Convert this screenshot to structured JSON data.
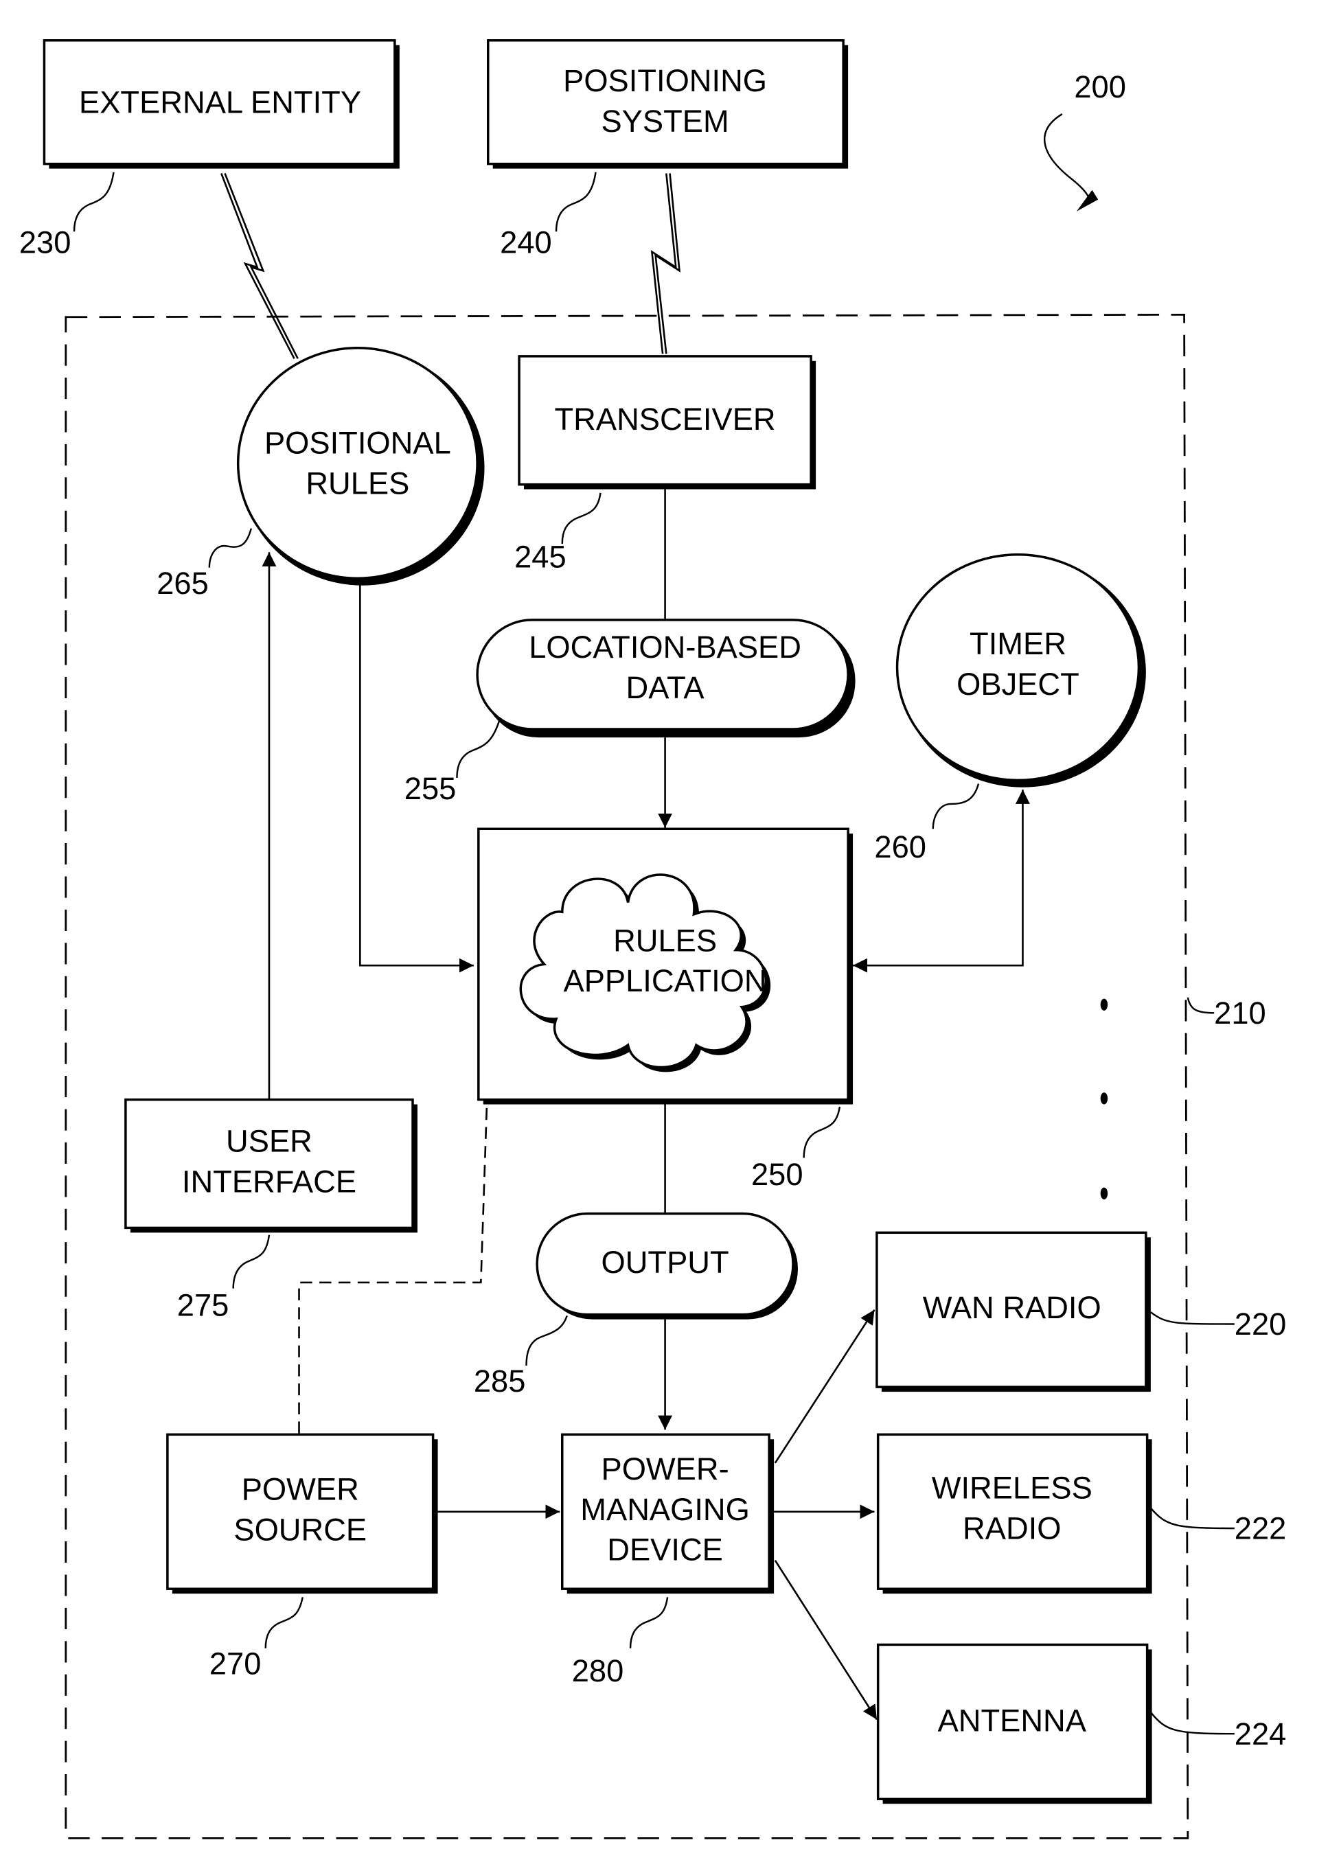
{
  "figure": {
    "ref": "200",
    "container_ref": "210"
  },
  "nodes": {
    "external_entity": {
      "lines": [
        "EXTERNAL ENTITY"
      ],
      "ref": "230"
    },
    "positioning_system": {
      "lines": [
        "POSITIONING",
        "SYSTEM"
      ],
      "ref": "240"
    },
    "positional_rules": {
      "lines": [
        "POSITIONAL",
        "RULES"
      ],
      "ref": "265"
    },
    "transceiver": {
      "lines": [
        "TRANSCEIVER"
      ],
      "ref": "245"
    },
    "location_based_data": {
      "lines": [
        "LOCATION-BASED",
        "DATA"
      ],
      "ref": "255"
    },
    "timer_object": {
      "lines": [
        "TIMER",
        "OBJECT"
      ],
      "ref": "260"
    },
    "rules_application": {
      "lines": [
        "RULES",
        "APPLICATION"
      ],
      "ref": "250"
    },
    "user_interface": {
      "lines": [
        "USER",
        "INTERFACE"
      ],
      "ref": "275"
    },
    "output": {
      "lines": [
        "OUTPUT"
      ],
      "ref": "285"
    },
    "wan_radio": {
      "lines": [
        "WAN RADIO"
      ],
      "ref": "220"
    },
    "power_source": {
      "lines": [
        "POWER",
        "SOURCE"
      ],
      "ref": "270"
    },
    "power_managing_device": {
      "lines": [
        "POWER-",
        "MANAGING",
        "DEVICE"
      ],
      "ref": "280"
    },
    "wireless_radio": {
      "lines": [
        "WIRELESS",
        "RADIO"
      ],
      "ref": "222"
    },
    "antenna": {
      "lines": [
        "ANTENNA"
      ],
      "ref": "224"
    }
  },
  "connections": [
    {
      "from": "external_entity",
      "to": "positional_rules",
      "type": "wireless"
    },
    {
      "from": "positioning_system",
      "to": "transceiver",
      "type": "wireless"
    },
    {
      "from": "transceiver",
      "to": "location_based_data",
      "type": "line"
    },
    {
      "from": "location_based_data",
      "to": "rules_application",
      "type": "arrow"
    },
    {
      "from": "positional_rules",
      "to": "rules_application",
      "type": "arrow"
    },
    {
      "from": "timer_object",
      "to": "rules_application",
      "type": "bidirectional-arrow"
    },
    {
      "from": "user_interface",
      "to": "positional_rules",
      "type": "arrow"
    },
    {
      "from": "rules_application",
      "to": "output",
      "type": "line"
    },
    {
      "from": "output",
      "to": "power_managing_device",
      "type": "arrow"
    },
    {
      "from": "power_source",
      "to": "power_managing_device",
      "type": "arrow"
    },
    {
      "from": "power_source",
      "to": "rules_application",
      "type": "dashed"
    },
    {
      "from": "power_managing_device",
      "to": "wan_radio",
      "type": "arrow"
    },
    {
      "from": "power_managing_device",
      "to": "wireless_radio",
      "type": "arrow"
    },
    {
      "from": "power_managing_device",
      "to": "antenna",
      "type": "arrow"
    }
  ]
}
